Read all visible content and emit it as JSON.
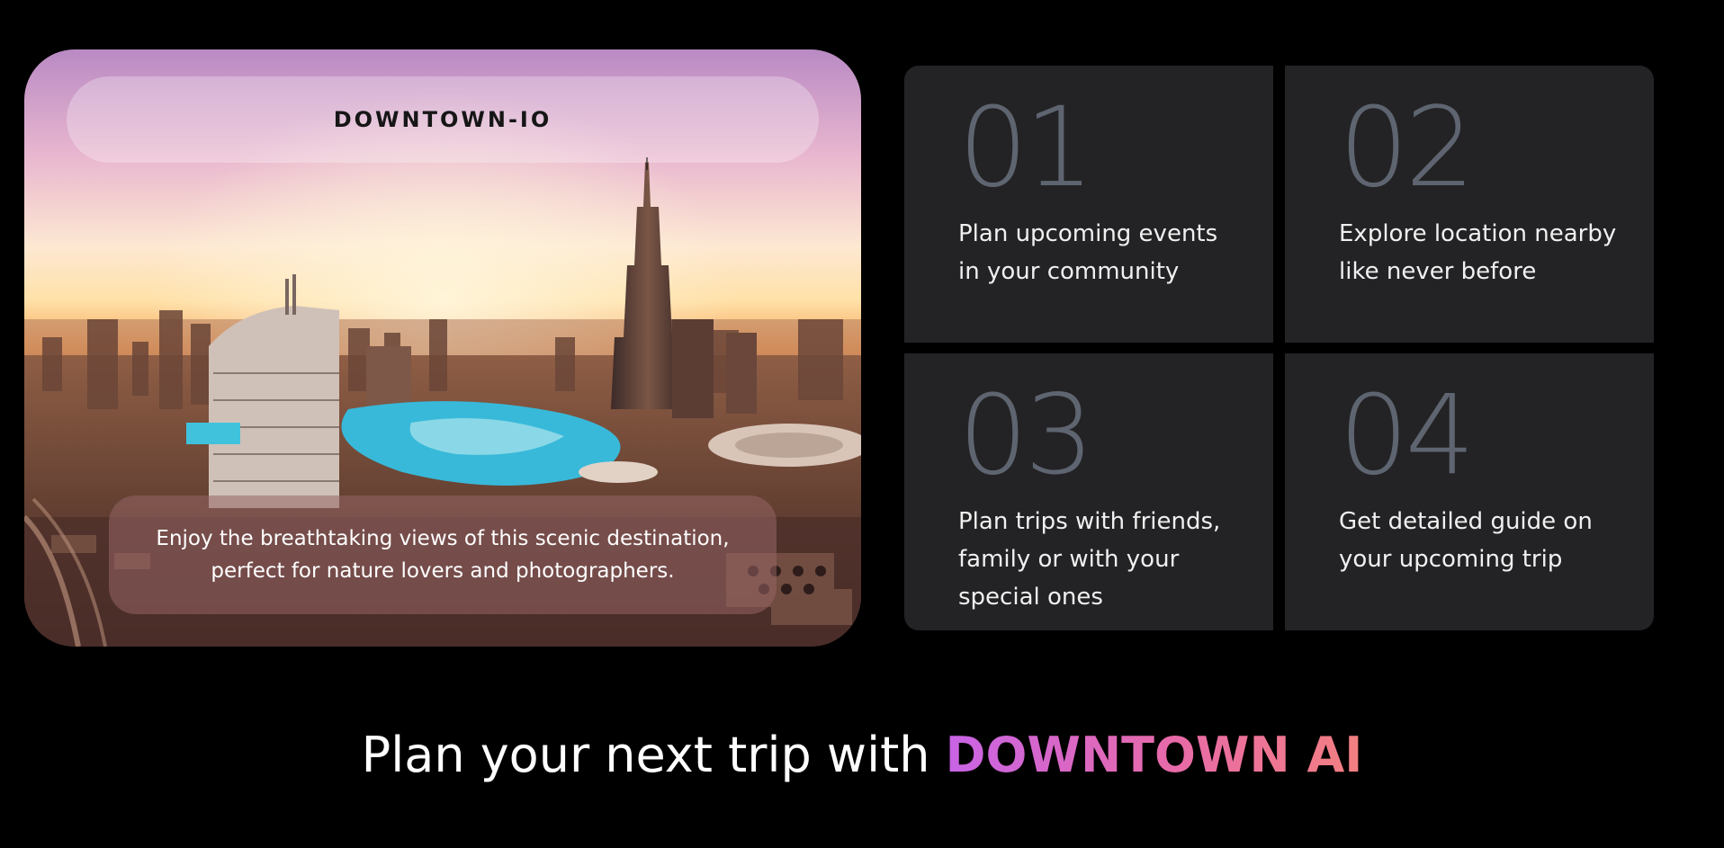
{
  "hero": {
    "title": "DOWNTOWN-IO",
    "caption": "Enjoy the breathtaking views of this scenic destination, perfect for nature lovers and photographers."
  },
  "features": [
    {
      "number": "01",
      "text": "Plan upcoming events in your community"
    },
    {
      "number": "02",
      "text": "Explore location nearby like never before"
    },
    {
      "number": "03",
      "text": "Plan trips with friends, family or with your special ones"
    },
    {
      "number": "04",
      "text": "Get detailed guide on your upcoming trip"
    }
  ],
  "tagline": {
    "prefix": "Plan your next trip with ",
    "brand": "DOWNTOWN AI"
  },
  "colors": {
    "background": "#000000",
    "tile": "#232325",
    "number": "#5e6570",
    "brand_gradient_start": "#c864e6",
    "brand_gradient_end": "#f28080"
  }
}
